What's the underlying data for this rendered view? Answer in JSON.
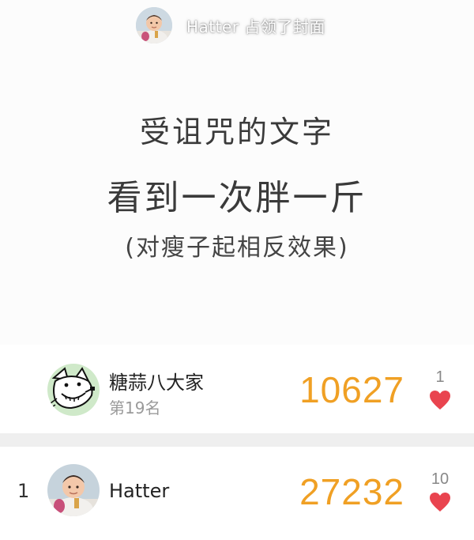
{
  "cover": {
    "owner_text": "Hatter 占领了封面",
    "lines": [
      "受诅咒的文字",
      "看到一次胖一斤",
      "(对瘦子起相反效果)"
    ]
  },
  "my_entry": {
    "name": "糖蒜八大家",
    "subrank": "第19名",
    "score": "10627",
    "likes": "1"
  },
  "leaderboard": [
    {
      "rank": "1",
      "name": "Hatter",
      "score": "27232",
      "likes": "10"
    }
  ],
  "colors": {
    "score": "#f0a024",
    "heart": "#e9444f",
    "separator": "#efefef"
  },
  "icons": {
    "like": "heart-icon"
  }
}
